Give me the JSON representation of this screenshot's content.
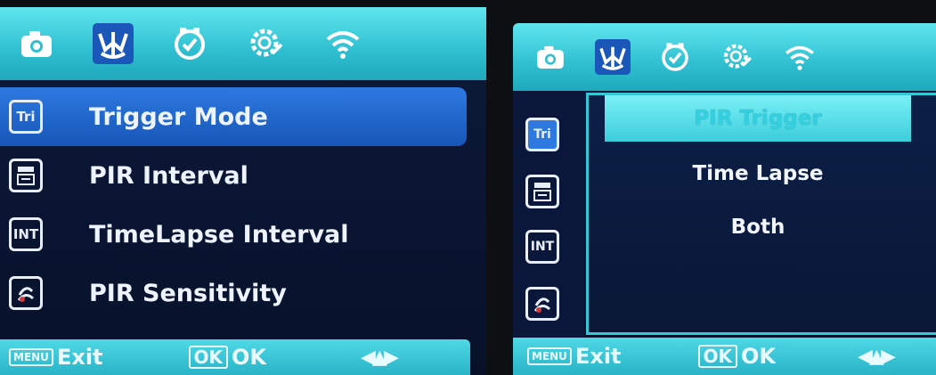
{
  "left_screen": {
    "top_icons": [
      "camera-icon",
      "trigger-settings-icon",
      "clock-icon",
      "gear-icon",
      "wifi-icon"
    ],
    "active_top_icon": "trigger-settings-icon",
    "menu": [
      {
        "icon_text": "Tri",
        "label": "Trigger Mode",
        "selected": true
      },
      {
        "icon_text": "",
        "label": "PIR Interval",
        "selected": false
      },
      {
        "icon_text": "INT",
        "label": "TimeLapse Interval",
        "selected": false
      },
      {
        "icon_text": "",
        "label": "PIR Sensitivity",
        "selected": false
      }
    ],
    "bottom": {
      "menu_tag": "MENU",
      "exit": "Exit",
      "ok_tag": "OK",
      "ok": "OK"
    }
  },
  "right_screen": {
    "side_icons": [
      {
        "icon_text": "Tri"
      },
      {
        "icon_text": ""
      },
      {
        "icon_text": "INT"
      },
      {
        "icon_text": ""
      }
    ],
    "submenu": [
      {
        "label": "PIR Trigger",
        "selected": true
      },
      {
        "label": "Time Lapse",
        "selected": false
      },
      {
        "label": "Both",
        "selected": false
      }
    ],
    "bottom": {
      "menu_tag": "MENU",
      "exit": "Exit",
      "ok_tag": "OK",
      "ok": "OK"
    }
  },
  "colors": {
    "topbar": "#2fbfd0",
    "active_tab": "#1a57b8",
    "menu_highlight": "#2d79e0",
    "submenu_highlight": "#5be0ea",
    "background": "#0c1a3a"
  }
}
